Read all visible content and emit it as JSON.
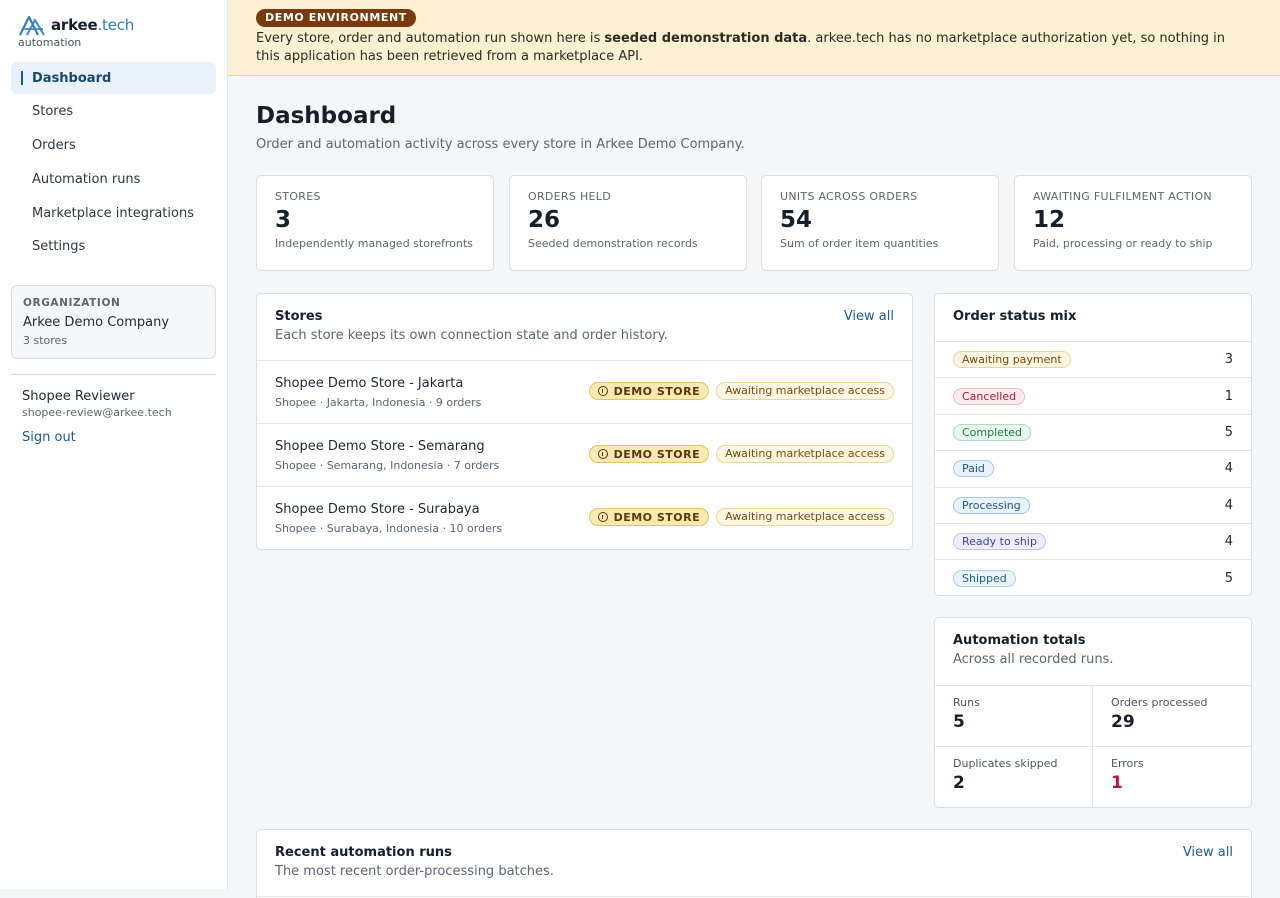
{
  "brand": {
    "name": "arkee",
    "tld": ".tech",
    "subtitle": "automation"
  },
  "nav": [
    {
      "label": "Dashboard",
      "active": true
    },
    {
      "label": "Stores"
    },
    {
      "label": "Orders"
    },
    {
      "label": "Automation runs"
    },
    {
      "label": "Marketplace integrations"
    },
    {
      "label": "Settings"
    }
  ],
  "org": {
    "label": "ORGANIZATION",
    "name": "Arkee Demo Company",
    "count": "3 stores"
  },
  "user": {
    "name": "Shopee Reviewer",
    "email": "shopee-review@arkee.tech",
    "sign_out": "Sign out"
  },
  "banner": {
    "badge": "DEMO ENVIRONMENT",
    "text_before": "Every store, order and automation run shown here is ",
    "text_bold": "seeded demonstration data",
    "text_after": ". arkee.tech has no marketplace authorization yet, so nothing in this application has been retrieved from a marketplace API."
  },
  "page": {
    "title": "Dashboard",
    "subtitle": "Order and automation activity across every store in Arkee Demo Company."
  },
  "stats": [
    {
      "label": "STORES",
      "value": "3",
      "note": "Independently managed storefronts"
    },
    {
      "label": "ORDERS HELD",
      "value": "26",
      "note": "Seeded demonstration records"
    },
    {
      "label": "UNITS ACROSS ORDERS",
      "value": "54",
      "note": "Sum of order item quantities"
    },
    {
      "label": "AWAITING FULFILMENT ACTION",
      "value": "12",
      "note": "Paid, processing or ready to ship"
    }
  ],
  "stores": {
    "title": "Stores",
    "subtitle": "Each store keeps its own connection state and order history.",
    "view_all": "View all",
    "demo_badge": "DEMO STORE",
    "status_badge": "Awaiting marketplace access",
    "items": [
      {
        "name": "Shopee Demo Store - Jakarta",
        "meta": "Shopee · Jakarta, Indonesia · 9 orders"
      },
      {
        "name": "Shopee Demo Store - Semarang",
        "meta": "Shopee · Semarang, Indonesia · 7 orders"
      },
      {
        "name": "Shopee Demo Store - Surabaya",
        "meta": "Shopee · Surabaya, Indonesia · 10 orders"
      }
    ]
  },
  "status_mix": {
    "title": "Order status mix",
    "items": [
      {
        "label": "Awaiting payment",
        "count": "3",
        "bg": "#fdf6e3",
        "border": "#ecd796",
        "fg": "#7a4a0a"
      },
      {
        "label": "Cancelled",
        "count": "1",
        "bg": "#fdecef",
        "border": "#f3b6c2",
        "fg": "#b0173b"
      },
      {
        "label": "Completed",
        "count": "5",
        "bg": "#e8f7ef",
        "border": "#a9dfc0",
        "fg": "#1b7a45"
      },
      {
        "label": "Paid",
        "count": "4",
        "bg": "#e9f2fb",
        "border": "#a9c9ea",
        "fg": "#1b5b8e"
      },
      {
        "label": "Processing",
        "count": "4",
        "bg": "#e8f3fb",
        "border": "#9fc9e8",
        "fg": "#1b5b8e"
      },
      {
        "label": "Ready to ship",
        "count": "4",
        "bg": "#eeeefc",
        "border": "#c2c3ef",
        "fg": "#3d3f9e"
      },
      {
        "label": "Shipped",
        "count": "5",
        "bg": "#e8f4fa",
        "border": "#a8d3e6",
        "fg": "#1d5f80"
      }
    ]
  },
  "automation": {
    "title": "Automation totals",
    "subtitle": "Across all recorded runs.",
    "cells": [
      {
        "label": "Runs",
        "value": "5"
      },
      {
        "label": "Orders processed",
        "value": "29"
      },
      {
        "label": "Duplicates skipped",
        "value": "2"
      },
      {
        "label": "Errors",
        "value": "1"
      }
    ]
  },
  "runs": {
    "title": "Recent automation runs",
    "subtitle": "The most recent order-processing batches.",
    "view_all": "View all"
  }
}
